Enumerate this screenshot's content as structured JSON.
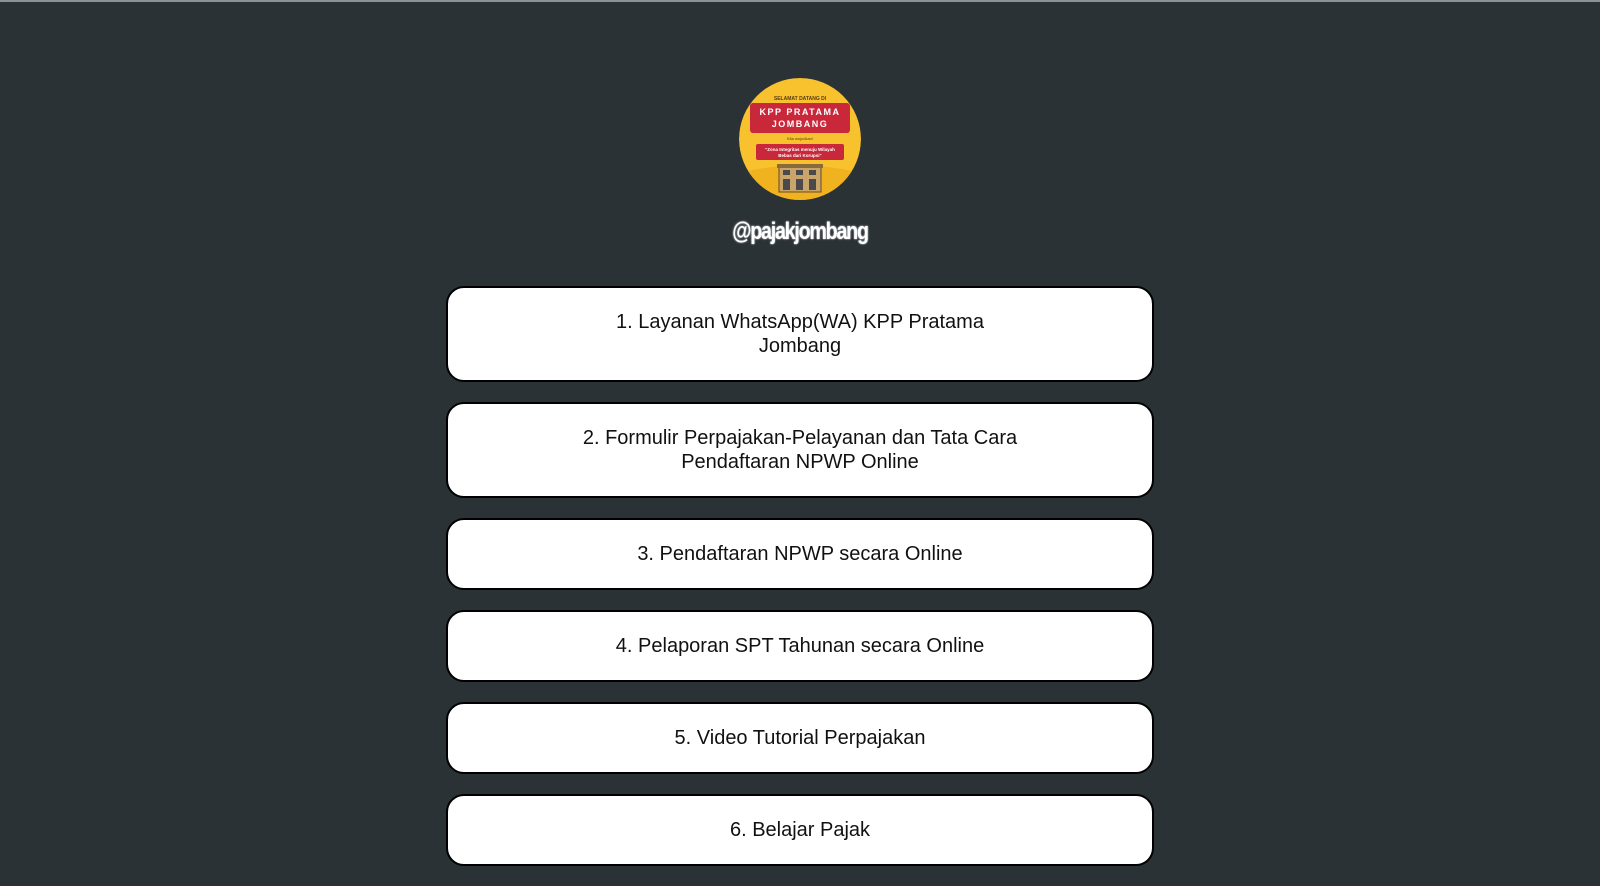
{
  "profile": {
    "handle": "@pajakjombang",
    "avatar": {
      "icon": "kpp-logo-icon",
      "welcome": "SELAMAT DATANG DI",
      "office_line1": "KPP PRATAMA",
      "office_line2": "JOMBANG",
      "subtitle": "Kita wujudkan!",
      "motto_line1": "\"Zona Integritas menuju Wilayah",
      "motto_line2": "Bebas dari Korupsi\"",
      "colors": {
        "background": "#f7c22e",
        "banner": "#c8283a",
        "building": "#c9a46b"
      }
    }
  },
  "links": [
    {
      "label": "1. Layanan WhatsApp(WA) KPP Pratama Jombang"
    },
    {
      "label": "2. Formulir Perpajakan-Pelayanan dan Tata Cara Pendaftaran NPWP Online"
    },
    {
      "label": "3. Pendaftaran NPWP secara Online"
    },
    {
      "label": "4. Pelaporan SPT Tahunan secara Online"
    },
    {
      "label": "5. Video Tutorial Perpajakan"
    },
    {
      "label": "6. Belajar Pajak"
    }
  ],
  "theme": {
    "background": "#2b3236",
    "button_background": "#ffffff",
    "button_border": "#000000",
    "handle_color": "#ffffff"
  }
}
